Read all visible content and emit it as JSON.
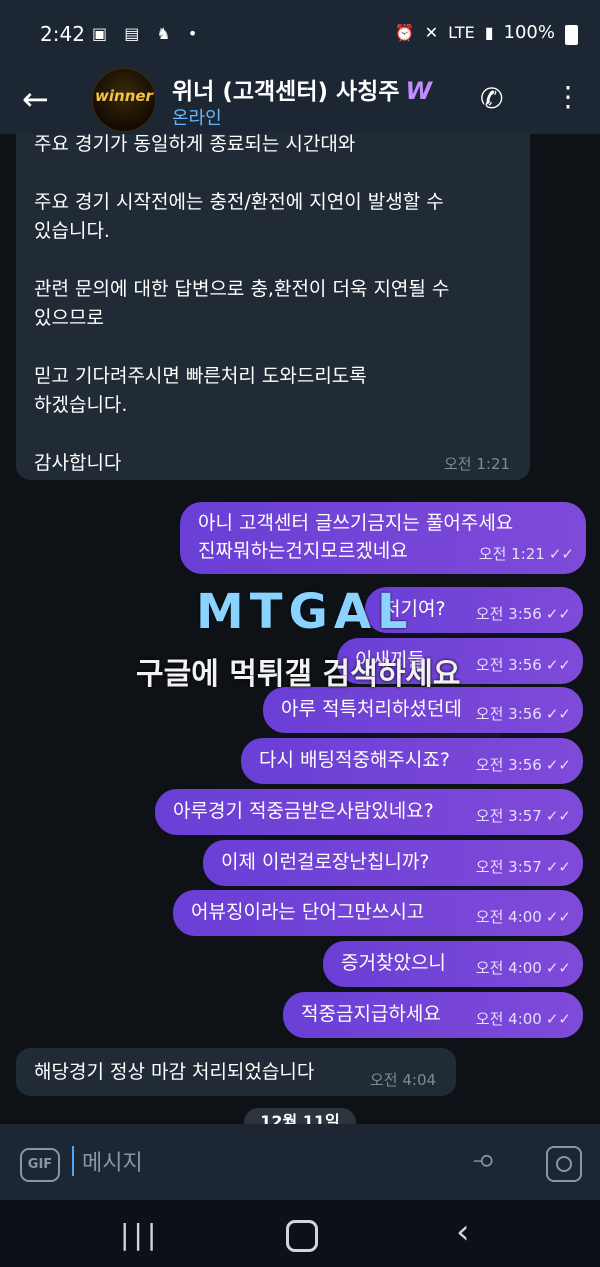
{
  "status_bar": {
    "time": "2:42",
    "left_icons": [
      "image-icon",
      "chat-icon",
      "accessibility-icon",
      "dot-icon"
    ],
    "network": "LTE",
    "battery": "100%"
  },
  "header": {
    "back_glyph": "←",
    "avatar_text": "winner",
    "title": "위너 (고객센터) 사칭주",
    "title_badge": "W",
    "subtitle": "온라인",
    "call_glyph": "✆",
    "menu_glyph": "⋮"
  },
  "messages": {
    "incoming_1": {
      "lines": [
        "주요 경기가 동일하게 종료되는 시간대와",
        "",
        "주요 경기 시작전에는 충전/환전에 지연이 발생할 수",
        "있습니다.",
        "",
        "관련 문의에 대한 답변으로 충,환전이 더욱 지연될 수",
        "있으므로",
        "",
        "믿고 기다려주시면 빠른처리 도와드리도록",
        "하겠습니다.",
        "",
        "감사합니다"
      ],
      "time": "오전 1:21"
    },
    "outgoing": [
      {
        "text_1": "아니 고객센터 글쓰기금지는 풀어주세요",
        "text_2": "진짜뭐하는건지모르겠네요",
        "time": "오전 1:21"
      },
      {
        "text": "저기여?",
        "time": "오전 3:56"
      },
      {
        "text": "이새끼들",
        "time": "오전 3:56"
      },
      {
        "text": "아루 적특처리하셨던데",
        "time": "오전 3:56"
      },
      {
        "text": "다시 배팅적중해주시죠?",
        "time": "오전 3:56"
      },
      {
        "text": "아루경기 적중금받은사람있네요?",
        "time": "오전 3:57"
      },
      {
        "text": "이제 이런걸로장난칩니까?",
        "time": "오전 3:57"
      },
      {
        "text": "어뷰징이라는 단어그만쓰시고",
        "time": "오전 4:00"
      },
      {
        "text": "증거찾았으니",
        "time": "오전 4:00"
      },
      {
        "text": "적중금지급하세요",
        "time": "오전 4:00"
      }
    ],
    "incoming_2": {
      "text": "해당경기 정상 마감 처리되었습니다",
      "time": "오전 4:04"
    },
    "read_checks": "✓✓"
  },
  "watermark": {
    "logo": "MTGAL",
    "text": "구글에 먹튀갤 검색하세요"
  },
  "date_divider": "12월 11일",
  "input_bar": {
    "gif_label": "GIF",
    "placeholder": "메시지"
  },
  "nav_bar": {
    "recents_glyph": "|||",
    "back_glyph": "‹"
  }
}
